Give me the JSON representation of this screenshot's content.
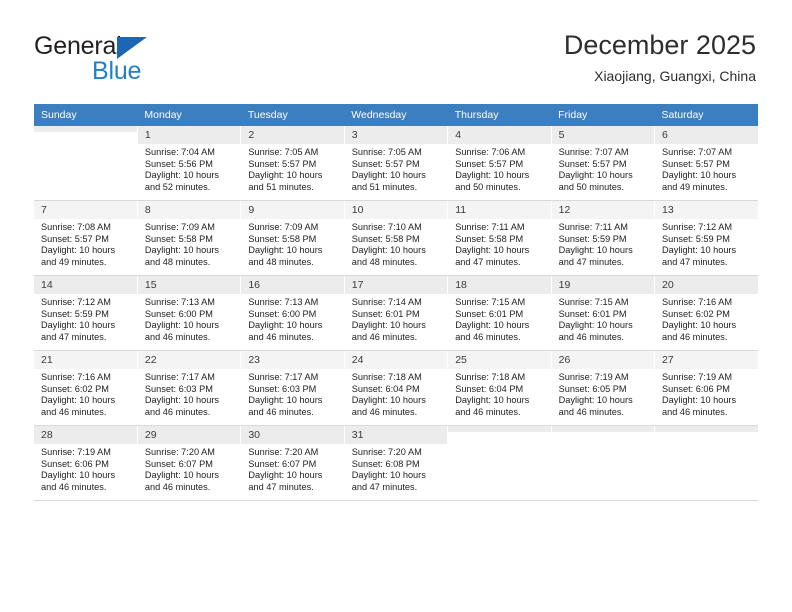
{
  "logo": {
    "word_top": "General",
    "word_bottom": "Blue",
    "triangle_color": "#1c67b3",
    "blue_color": "#2280c8"
  },
  "header": {
    "title": "December 2025",
    "subtitle": "Xiaojiang, Guangxi, China"
  },
  "theme": {
    "header_row_bg": "#3c7fc1",
    "header_row_text": "#ffffff",
    "daynum_bg": "#f0f0f0",
    "grid_line": "#d9d9d9"
  },
  "weekdays": [
    "Sunday",
    "Monday",
    "Tuesday",
    "Wednesday",
    "Thursday",
    "Friday",
    "Saturday"
  ],
  "weeks": [
    [
      {
        "day": "",
        "sunrise": "",
        "sunset": "",
        "daylight_line1": "",
        "daylight_line2": "",
        "empty": true
      },
      {
        "day": "1",
        "sunrise": "Sunrise: 7:04 AM",
        "sunset": "Sunset: 5:56 PM",
        "daylight_line1": "Daylight: 10 hours",
        "daylight_line2": "and 52 minutes."
      },
      {
        "day": "2",
        "sunrise": "Sunrise: 7:05 AM",
        "sunset": "Sunset: 5:57 PM",
        "daylight_line1": "Daylight: 10 hours",
        "daylight_line2": "and 51 minutes."
      },
      {
        "day": "3",
        "sunrise": "Sunrise: 7:05 AM",
        "sunset": "Sunset: 5:57 PM",
        "daylight_line1": "Daylight: 10 hours",
        "daylight_line2": "and 51 minutes."
      },
      {
        "day": "4",
        "sunrise": "Sunrise: 7:06 AM",
        "sunset": "Sunset: 5:57 PM",
        "daylight_line1": "Daylight: 10 hours",
        "daylight_line2": "and 50 minutes."
      },
      {
        "day": "5",
        "sunrise": "Sunrise: 7:07 AM",
        "sunset": "Sunset: 5:57 PM",
        "daylight_line1": "Daylight: 10 hours",
        "daylight_line2": "and 50 minutes."
      },
      {
        "day": "6",
        "sunrise": "Sunrise: 7:07 AM",
        "sunset": "Sunset: 5:57 PM",
        "daylight_line1": "Daylight: 10 hours",
        "daylight_line2": "and 49 minutes."
      }
    ],
    [
      {
        "day": "7",
        "sunrise": "Sunrise: 7:08 AM",
        "sunset": "Sunset: 5:57 PM",
        "daylight_line1": "Daylight: 10 hours",
        "daylight_line2": "and 49 minutes."
      },
      {
        "day": "8",
        "sunrise": "Sunrise: 7:09 AM",
        "sunset": "Sunset: 5:58 PM",
        "daylight_line1": "Daylight: 10 hours",
        "daylight_line2": "and 48 minutes."
      },
      {
        "day": "9",
        "sunrise": "Sunrise: 7:09 AM",
        "sunset": "Sunset: 5:58 PM",
        "daylight_line1": "Daylight: 10 hours",
        "daylight_line2": "and 48 minutes."
      },
      {
        "day": "10",
        "sunrise": "Sunrise: 7:10 AM",
        "sunset": "Sunset: 5:58 PM",
        "daylight_line1": "Daylight: 10 hours",
        "daylight_line2": "and 48 minutes."
      },
      {
        "day": "11",
        "sunrise": "Sunrise: 7:11 AM",
        "sunset": "Sunset: 5:58 PM",
        "daylight_line1": "Daylight: 10 hours",
        "daylight_line2": "and 47 minutes."
      },
      {
        "day": "12",
        "sunrise": "Sunrise: 7:11 AM",
        "sunset": "Sunset: 5:59 PM",
        "daylight_line1": "Daylight: 10 hours",
        "daylight_line2": "and 47 minutes."
      },
      {
        "day": "13",
        "sunrise": "Sunrise: 7:12 AM",
        "sunset": "Sunset: 5:59 PM",
        "daylight_line1": "Daylight: 10 hours",
        "daylight_line2": "and 47 minutes."
      }
    ],
    [
      {
        "day": "14",
        "sunrise": "Sunrise: 7:12 AM",
        "sunset": "Sunset: 5:59 PM",
        "daylight_line1": "Daylight: 10 hours",
        "daylight_line2": "and 47 minutes."
      },
      {
        "day": "15",
        "sunrise": "Sunrise: 7:13 AM",
        "sunset": "Sunset: 6:00 PM",
        "daylight_line1": "Daylight: 10 hours",
        "daylight_line2": "and 46 minutes."
      },
      {
        "day": "16",
        "sunrise": "Sunrise: 7:13 AM",
        "sunset": "Sunset: 6:00 PM",
        "daylight_line1": "Daylight: 10 hours",
        "daylight_line2": "and 46 minutes."
      },
      {
        "day": "17",
        "sunrise": "Sunrise: 7:14 AM",
        "sunset": "Sunset: 6:01 PM",
        "daylight_line1": "Daylight: 10 hours",
        "daylight_line2": "and 46 minutes."
      },
      {
        "day": "18",
        "sunrise": "Sunrise: 7:15 AM",
        "sunset": "Sunset: 6:01 PM",
        "daylight_line1": "Daylight: 10 hours",
        "daylight_line2": "and 46 minutes."
      },
      {
        "day": "19",
        "sunrise": "Sunrise: 7:15 AM",
        "sunset": "Sunset: 6:01 PM",
        "daylight_line1": "Daylight: 10 hours",
        "daylight_line2": "and 46 minutes."
      },
      {
        "day": "20",
        "sunrise": "Sunrise: 7:16 AM",
        "sunset": "Sunset: 6:02 PM",
        "daylight_line1": "Daylight: 10 hours",
        "daylight_line2": "and 46 minutes."
      }
    ],
    [
      {
        "day": "21",
        "sunrise": "Sunrise: 7:16 AM",
        "sunset": "Sunset: 6:02 PM",
        "daylight_line1": "Daylight: 10 hours",
        "daylight_line2": "and 46 minutes."
      },
      {
        "day": "22",
        "sunrise": "Sunrise: 7:17 AM",
        "sunset": "Sunset: 6:03 PM",
        "daylight_line1": "Daylight: 10 hours",
        "daylight_line2": "and 46 minutes."
      },
      {
        "day": "23",
        "sunrise": "Sunrise: 7:17 AM",
        "sunset": "Sunset: 6:03 PM",
        "daylight_line1": "Daylight: 10 hours",
        "daylight_line2": "and 46 minutes."
      },
      {
        "day": "24",
        "sunrise": "Sunrise: 7:18 AM",
        "sunset": "Sunset: 6:04 PM",
        "daylight_line1": "Daylight: 10 hours",
        "daylight_line2": "and 46 minutes."
      },
      {
        "day": "25",
        "sunrise": "Sunrise: 7:18 AM",
        "sunset": "Sunset: 6:04 PM",
        "daylight_line1": "Daylight: 10 hours",
        "daylight_line2": "and 46 minutes."
      },
      {
        "day": "26",
        "sunrise": "Sunrise: 7:19 AM",
        "sunset": "Sunset: 6:05 PM",
        "daylight_line1": "Daylight: 10 hours",
        "daylight_line2": "and 46 minutes."
      },
      {
        "day": "27",
        "sunrise": "Sunrise: 7:19 AM",
        "sunset": "Sunset: 6:06 PM",
        "daylight_line1": "Daylight: 10 hours",
        "daylight_line2": "and 46 minutes."
      }
    ],
    [
      {
        "day": "28",
        "sunrise": "Sunrise: 7:19 AM",
        "sunset": "Sunset: 6:06 PM",
        "daylight_line1": "Daylight: 10 hours",
        "daylight_line2": "and 46 minutes."
      },
      {
        "day": "29",
        "sunrise": "Sunrise: 7:20 AM",
        "sunset": "Sunset: 6:07 PM",
        "daylight_line1": "Daylight: 10 hours",
        "daylight_line2": "and 46 minutes."
      },
      {
        "day": "30",
        "sunrise": "Sunrise: 7:20 AM",
        "sunset": "Sunset: 6:07 PM",
        "daylight_line1": "Daylight: 10 hours",
        "daylight_line2": "and 47 minutes."
      },
      {
        "day": "31",
        "sunrise": "Sunrise: 7:20 AM",
        "sunset": "Sunset: 6:08 PM",
        "daylight_line1": "Daylight: 10 hours",
        "daylight_line2": "and 47 minutes."
      },
      {
        "day": "",
        "sunrise": "",
        "sunset": "",
        "daylight_line1": "",
        "daylight_line2": "",
        "empty": true
      },
      {
        "day": "",
        "sunrise": "",
        "sunset": "",
        "daylight_line1": "",
        "daylight_line2": "",
        "empty": true
      },
      {
        "day": "",
        "sunrise": "",
        "sunset": "",
        "daylight_line1": "",
        "daylight_line2": "",
        "empty": true
      }
    ]
  ]
}
